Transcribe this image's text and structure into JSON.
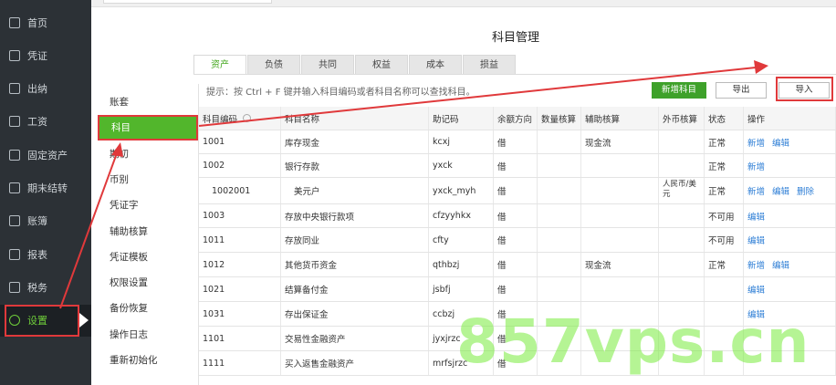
{
  "sidebar": {
    "items": [
      {
        "label": "首页",
        "icon": "home-icon"
      },
      {
        "label": "凭证",
        "icon": "voucher-icon"
      },
      {
        "label": "出纳",
        "icon": "cashier-icon"
      },
      {
        "label": "工资",
        "icon": "salary-icon"
      },
      {
        "label": "固定资产",
        "icon": "assets-icon"
      },
      {
        "label": "期末结转",
        "icon": "calendar-icon"
      },
      {
        "label": "账簿",
        "icon": "ledger-icon"
      },
      {
        "label": "报表",
        "icon": "report-icon"
      },
      {
        "label": "税务",
        "icon": "tax-icon"
      },
      {
        "label": "设置",
        "icon": "gear-icon"
      }
    ]
  },
  "submenu": {
    "items": [
      "账套",
      "科目",
      "期初",
      "币别",
      "凭证字",
      "辅助核算",
      "凭证模板",
      "权限设置",
      "备份恢复",
      "操作日志",
      "重新初始化"
    ]
  },
  "page": {
    "title": "科目管理"
  },
  "tabs": [
    "资产",
    "负债",
    "共同",
    "权益",
    "成本",
    "损益"
  ],
  "toolbar": {
    "hint": "提示：按 Ctrl + F 键并输入科目编码或者科目名称可以查找科目。",
    "add_label": "新增科目",
    "export_label": "导出",
    "import_label": "导入"
  },
  "table": {
    "headers": [
      "科目编码",
      "科目名称",
      "助记码",
      "余额方向",
      "数量核算",
      "辅助核算",
      "外币核算",
      "状态",
      "操作"
    ],
    "rows": [
      {
        "code": "1001",
        "name": "库存现金",
        "mnemonic": "kcxj",
        "direction": "借",
        "qty": "",
        "aux": "现金流",
        "fx": "",
        "status": "正常",
        "ops": [
          "新增",
          "编辑"
        ]
      },
      {
        "code": "1002",
        "name": "银行存款",
        "mnemonic": "yxck",
        "direction": "借",
        "qty": "",
        "aux": "",
        "fx": "",
        "status": "正常",
        "ops": [
          "新增"
        ]
      },
      {
        "code": "1002001",
        "name": "美元户",
        "mnemonic": "yxck_myh",
        "direction": "借",
        "qty": "",
        "aux": "",
        "fx": "人民币/美元",
        "status": "正常",
        "ops": [
          "新增",
          "编辑",
          "删除"
        ]
      },
      {
        "code": "1003",
        "name": "存放中央银行款项",
        "mnemonic": "cfzyyhkx",
        "direction": "借",
        "qty": "",
        "aux": "",
        "fx": "",
        "status": "不可用",
        "ops": [
          "编辑"
        ]
      },
      {
        "code": "1011",
        "name": "存放同业",
        "mnemonic": "cfty",
        "direction": "借",
        "qty": "",
        "aux": "",
        "fx": "",
        "status": "不可用",
        "ops": [
          "编辑"
        ]
      },
      {
        "code": "1012",
        "name": "其他货币资金",
        "mnemonic": "qthbzj",
        "direction": "借",
        "qty": "",
        "aux": "现金流",
        "fx": "",
        "status": "正常",
        "ops": [
          "新增",
          "编辑"
        ]
      },
      {
        "code": "1021",
        "name": "结算备付金",
        "mnemonic": "jsbfj",
        "direction": "借",
        "qty": "",
        "aux": "",
        "fx": "",
        "status": "",
        "ops": [
          "编辑"
        ]
      },
      {
        "code": "1031",
        "name": "存出保证金",
        "mnemonic": "ccbzj",
        "direction": "借",
        "qty": "",
        "aux": "",
        "fx": "",
        "status": "",
        "ops": [
          "编辑"
        ]
      },
      {
        "code": "1101",
        "name": "交易性金融资产",
        "mnemonic": "jyxjrzc",
        "direction": "借",
        "qty": "",
        "aux": "",
        "fx": "",
        "status": "",
        "ops": []
      },
      {
        "code": "1111",
        "name": "买入返售金融资产",
        "mnemonic": "mrfsjrzc",
        "direction": "借",
        "qty": "",
        "aux": "",
        "fx": "",
        "status": "",
        "ops": []
      }
    ]
  },
  "watermark": "857vps.cn",
  "colors": {
    "accent": "#52b62c",
    "sidebar_bg": "#2c3136",
    "annotation": "#e0393b",
    "link": "#2f7fd6"
  }
}
